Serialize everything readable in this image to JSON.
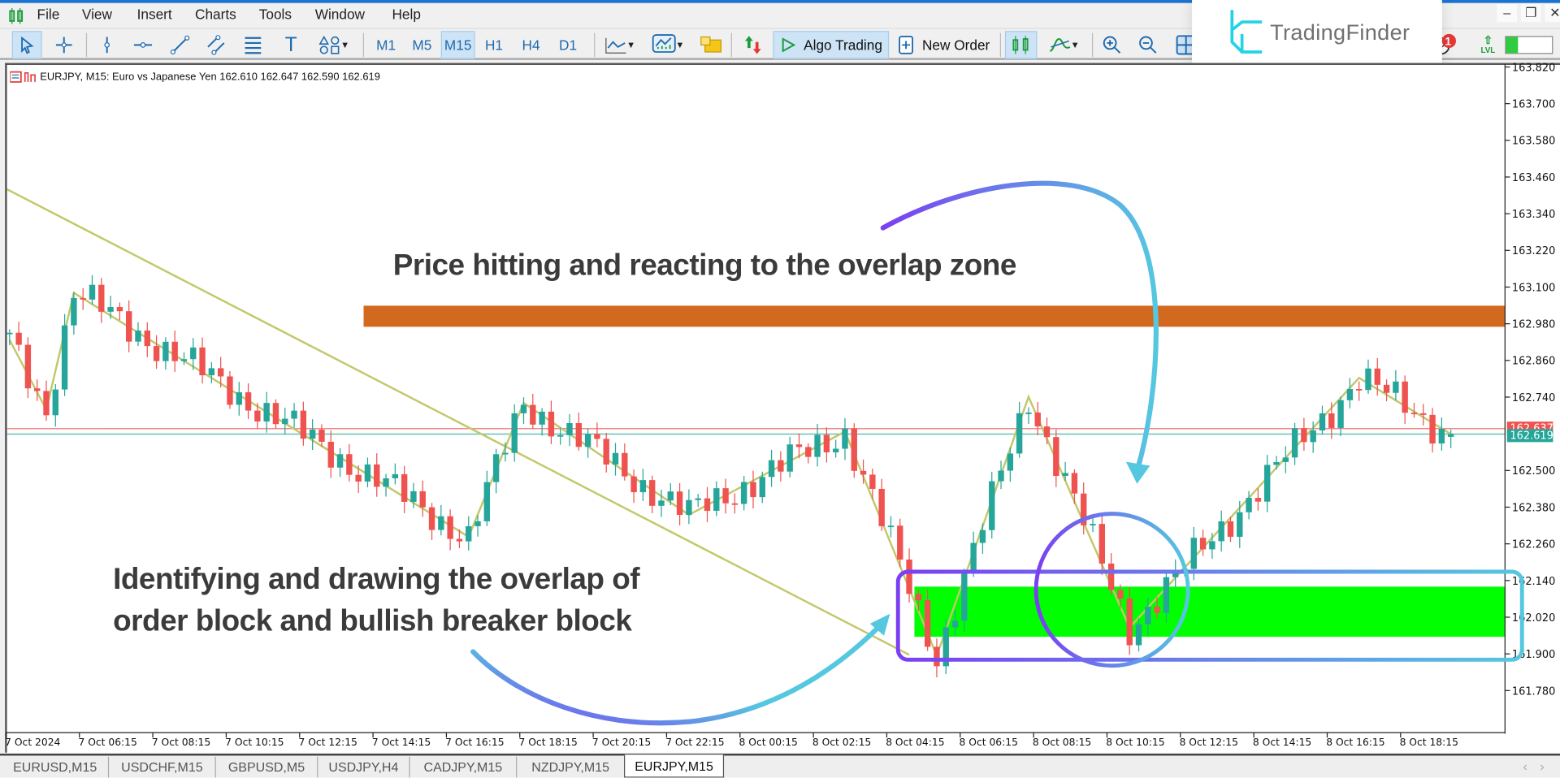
{
  "menu": {
    "items": [
      "File",
      "View",
      "Insert",
      "Charts",
      "Tools",
      "Window",
      "Help"
    ]
  },
  "toolbar": {
    "timeframes": [
      "M1",
      "M5",
      "M15",
      "H1",
      "H4",
      "D1"
    ],
    "active_timeframe": "M15",
    "algo_trading_label": "Algo Trading",
    "new_order_label": "New Order"
  },
  "brand": {
    "logo_text": "TradingFinder",
    "accent": "#22d3e6"
  },
  "status": {
    "notification_count": "1",
    "level_label": "LVL",
    "level_progress": 0.25
  },
  "chart": {
    "header": "EURJPY, M15:  Euro vs Japanese Yen  162.610 162.647 162.590 162.619",
    "annotation_top": "Price hitting and reacting to the overlap zone",
    "annotation_bottom_1": "Identifying and drawing the overlap of",
    "annotation_bottom_2": "order block and bullish breaker block"
  },
  "chart_data": {
    "type": "candlestick",
    "symbol": "EURJPY",
    "timeframe": "M15",
    "ohlc": {
      "open": 162.61,
      "high": 162.647,
      "low": 162.59,
      "close": 162.619
    },
    "price_axis": [
      "163.820",
      "163.700",
      "163.580",
      "163.460",
      "163.340",
      "163.220",
      "163.100",
      "162.980",
      "162.860",
      "162.740",
      "162.500",
      "162.380",
      "162.260",
      "162.140",
      "162.020",
      "161.900",
      "161.780"
    ],
    "price_axis_values": [
      163.82,
      163.7,
      163.58,
      163.46,
      163.34,
      163.22,
      163.1,
      162.98,
      162.86,
      162.74,
      162.5,
      162.38,
      162.26,
      162.14,
      162.02,
      161.9,
      161.78
    ],
    "ylim": [
      161.7,
      163.84
    ],
    "time_axis": [
      "7 Oct 2024",
      "7 Oct 06:15",
      "7 Oct 08:15",
      "7 Oct 10:15",
      "7 Oct 12:15",
      "7 Oct 14:15",
      "7 Oct 16:15",
      "7 Oct 18:15",
      "7 Oct 20:15",
      "7 Oct 22:15",
      "8 Oct 00:15",
      "8 Oct 02:15",
      "8 Oct 04:15",
      "8 Oct 06:15",
      "8 Oct 08:15",
      "8 Oct 10:15",
      "8 Oct 12:15",
      "8 Oct 14:15",
      "8 Oct 16:15",
      "8 Oct 18:15"
    ],
    "bid": {
      "label": "162.619",
      "price": 162.619,
      "color": "#26a69a"
    },
    "ask": {
      "label": "162.637",
      "price": 162.637,
      "color": "#ef5350"
    },
    "zigzag": [
      {
        "time": "7 Oct 04:15",
        "price": 162.927
      },
      {
        "time": "7 Oct 05:15",
        "price": 162.699
      },
      {
        "time": "7 Oct 06:00",
        "price": 163.081
      },
      {
        "time": "7 Oct 16:45",
        "price": 162.283
      },
      {
        "time": "7 Oct 18:15",
        "price": 162.721
      },
      {
        "time": "7 Oct 22:45",
        "price": 162.355
      },
      {
        "time": "8 Oct 03:00",
        "price": 162.627
      },
      {
        "time": "8 Oct 05:30",
        "price": 161.894
      },
      {
        "time": "8 Oct 08:00",
        "price": 162.741
      },
      {
        "time": "8 Oct 10:45",
        "price": 161.986
      },
      {
        "time": "8 Oct 17:00",
        "price": 162.803
      },
      {
        "time": "8 Oct 19:30",
        "price": 162.619
      }
    ],
    "trendline": [
      {
        "time": "7 Oct 04:15",
        "price": 163.424
      },
      {
        "time": "8 Oct 04:45",
        "price": 161.897
      }
    ],
    "zones": [
      {
        "kind": "order-block",
        "from": "7 Oct 14:00",
        "top": 163.039,
        "bottom": 162.97,
        "color": "#d2691e"
      },
      {
        "kind": "overlap-zone",
        "from": "8 Oct 05:00",
        "top": 162.12,
        "bottom": 161.956,
        "color": "#00ff00"
      }
    ],
    "colors": {
      "bull": "#26a69a",
      "bear": "#ef5350",
      "zigzag": "#c2c86a",
      "highlight_start": "#7b3ff2",
      "highlight_end": "#55c8e0"
    }
  },
  "tabs": [
    {
      "label": "EURUSD,M15"
    },
    {
      "label": "USDCHF,M15"
    },
    {
      "label": "GBPUSD,M5"
    },
    {
      "label": "USDJPY,H4"
    },
    {
      "label": "CADJPY,M15"
    },
    {
      "label": "NZDJPY,M15"
    },
    {
      "label": "EURJPY,M15",
      "active": true
    }
  ]
}
